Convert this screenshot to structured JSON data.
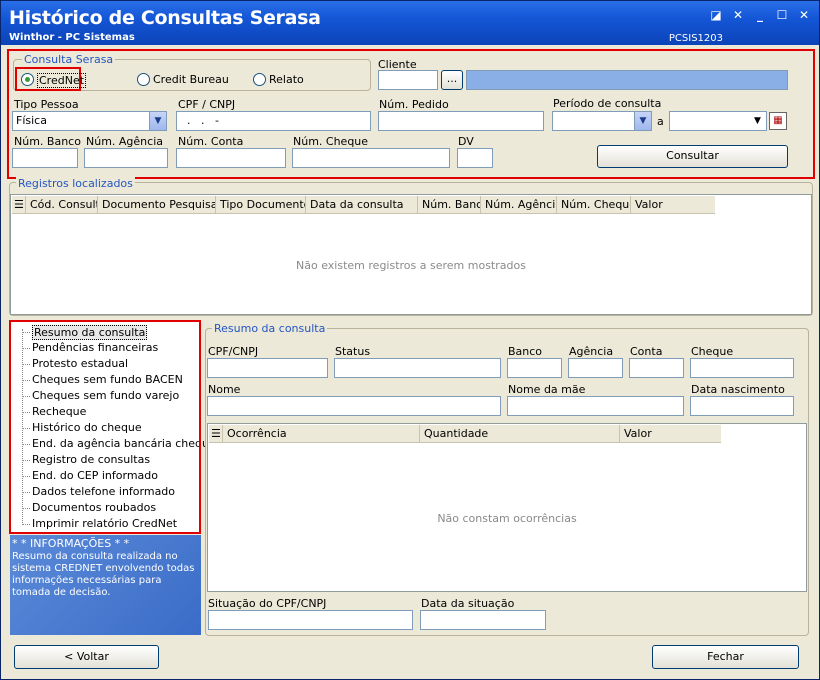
{
  "window": {
    "title": "Histórico de Consultas Serasa",
    "subtitle": "Winthor - PC Sistemas",
    "code": "PCSIS1203"
  },
  "consulta": {
    "group_title": "Consulta  Serasa",
    "options": [
      "CredNet",
      "Credit Bureau",
      "Relato"
    ],
    "selected": "CredNet",
    "cliente_label": "Cliente",
    "cliente_btn": "...",
    "tipo_pessoa_label": "Tipo Pessoa",
    "tipo_pessoa_value": "Física",
    "cpf_label": "CPF / CNPJ",
    "cpf_value": "  .   .   -",
    "pedido_label": "Núm. Pedido",
    "periodo_label": "Período de consulta",
    "periodo_sep": "a",
    "banco_label": "Núm. Banco",
    "agencia_label": "Núm. Agência",
    "conta_label": "Núm. Conta",
    "cheque_label": "Núm. Cheque",
    "dv_label": "DV",
    "consultar_btn": "Consultar"
  },
  "registros": {
    "title": "Registros localizados",
    "columns": [
      "Cód. Consulta",
      "Documento Pesquisado",
      "Tipo Documento",
      "Data da consulta",
      "Núm. Banco",
      "Núm. Agência",
      "Núm. Cheque",
      "Valor"
    ],
    "empty_text": "Não existem registros a serem mostrados"
  },
  "tree": {
    "items": [
      "Resumo da consulta",
      "Pendências financeiras",
      "Protesto estadual",
      "Cheques sem fundo BACEN",
      "Cheques sem fundo varejo",
      "Recheque",
      "Histórico do cheque",
      "End. da agência bancária cheque",
      "Registro de consultas",
      "End. do CEP informado",
      "Dados telefone informado",
      "Documentos roubados",
      "Imprimir relatório CredNet"
    ],
    "selected": "Resumo da consulta"
  },
  "info": {
    "title": "* * INFORMAÇÕES * *",
    "text": "Resumo da consulta realizada no sistema CREDNET envolvendo todas informações necessárias para tomada de decisão."
  },
  "resumo": {
    "title": "Resumo da consulta",
    "cpf_label": "CPF/CNPJ",
    "status_label": "Status",
    "banco_label": "Banco",
    "agencia_label": "Agência",
    "conta_label": "Conta",
    "cheque_label": "Cheque",
    "nome_label": "Nome",
    "mae_label": "Nome da mãe",
    "nasc_label": "Data nascimento",
    "columns": [
      "Ocorrência",
      "Quantidade",
      "Valor"
    ],
    "empty_text": "Não constam ocorrências",
    "situacao_label": "Situação do CPF/CNPJ",
    "data_situacao_label": "Data da situação"
  },
  "footer": {
    "voltar": "< Voltar",
    "fechar": "Fechar"
  },
  "colors": {
    "accent": "#2455c3",
    "highlight": "#e00000",
    "title_bar": "#1456d6"
  }
}
